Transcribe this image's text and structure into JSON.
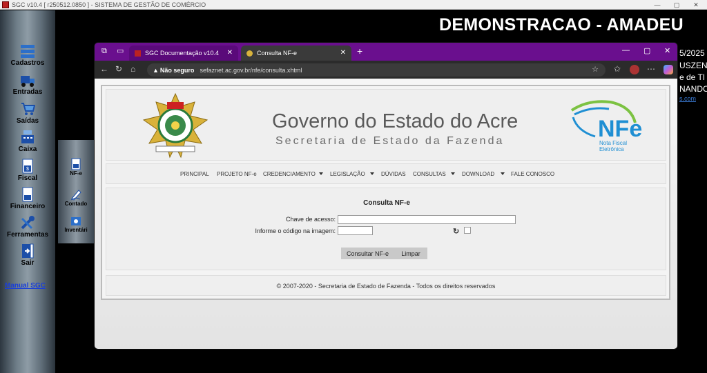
{
  "sgc_window": {
    "title": "SGC v10.4 [ r250512.0850 ] - SISTEMA DE GESTÃO DE COMÉRCIO",
    "controls": [
      "—",
      "▢",
      "✕"
    ]
  },
  "sidebar": {
    "items": [
      {
        "label": "Cadastros",
        "icon": "cadastros-icon"
      },
      {
        "label": "Entradas",
        "icon": "truck-icon"
      },
      {
        "label": "Saídas",
        "icon": "cart-icon"
      },
      {
        "label": "Caixa",
        "icon": "cash-register-icon"
      },
      {
        "label": "Fiscal",
        "icon": "fiscal-document-icon"
      },
      {
        "label": "Financeiro",
        "icon": "finance-document-icon"
      },
      {
        "label": "Ferramentas",
        "icon": "tools-icon"
      },
      {
        "label": "Sair",
        "icon": "exit-door-icon"
      }
    ],
    "manual_link": "Manual SGC"
  },
  "submenu": {
    "items": [
      {
        "label": "NF-e",
        "icon": "nfe-document-icon"
      },
      {
        "label": "Contado",
        "icon": "pen-signature-icon"
      },
      {
        "label": "Inventári",
        "icon": "inventory-icon"
      }
    ]
  },
  "demo": {
    "title": "DEMONSTRACAO - AMADEU",
    "side_lines": [
      "5/2025",
      "USZEN",
      "e de TI",
      "NANDO",
      "s.com"
    ]
  },
  "browser": {
    "tabs": [
      {
        "label": "SGC Documentação v10.4",
        "active": false
      },
      {
        "label": "Consulta NF-e",
        "active": true
      }
    ],
    "security_label": "Não seguro",
    "url": "sefaznet.ac.gov.br/nfe/consulta.xhtml",
    "window_controls": [
      "—",
      "▢",
      "✕"
    ]
  },
  "page": {
    "gov_title": "Governo do Estado do Acre",
    "sec_title": "Secretaria de Estado da Fazenda",
    "nfe_logo": {
      "big": "NFe",
      "line1": "Nota Fiscal",
      "line2": "Eletrônica"
    },
    "menu": [
      "PRINCIPAL",
      "PROJETO NF-e",
      "CREDENCIAMENTO",
      "LEGISLAÇÃO",
      "DÚVIDAS",
      "CONSULTAS",
      "DOWNLOAD",
      "FALE CONOSCO"
    ],
    "form": {
      "title": "Consulta NF-e",
      "chave_label": "Chave de acesso:",
      "chave_value": "",
      "captcha_label": "Informe o código na imagem:",
      "captcha_value": "",
      "consult_button": "Consultar NF-e",
      "clear_button": "Limpar"
    },
    "footer": "© 2007-2020 - Secretaria de Estado de Fazenda - Todos os direitos reservados"
  },
  "colors": {
    "tabstrip": "#6a0f8e",
    "nfe_green": "#7cc242",
    "nfe_blue": "#1f8fd3",
    "link_blue": "#1a3fd8"
  }
}
